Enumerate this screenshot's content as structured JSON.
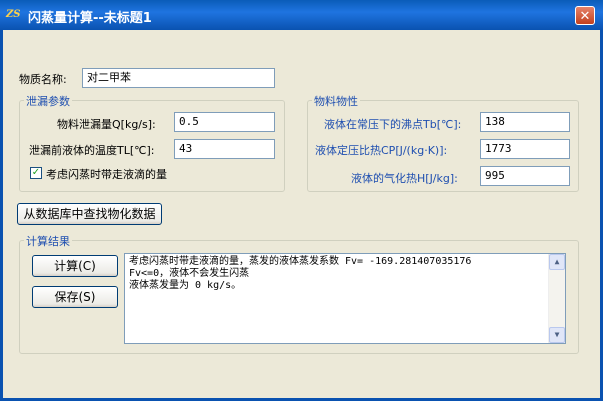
{
  "window": {
    "title": "闪蒸量计算--未标题1",
    "icon": "app-logo-icon",
    "icon_glyph": "ZS",
    "close_label": "✕"
  },
  "substance": {
    "label": "物质名称:",
    "value": "对二甲苯"
  },
  "leak_group": {
    "title": "泄漏参数",
    "leak_rate_label": "物料泄漏量Q[kg/s]:",
    "leak_rate_value": "0.5",
    "temperature_label": "泄漏前液体的温度TL[℃]:",
    "temperature_value": "43",
    "checkbox_label": "考虑闪蒸时带走液滴的量",
    "checkbox_checked": true,
    "check_glyph": "✓"
  },
  "properties_group": {
    "title": "物料物性",
    "boiling_point_label": "液体在常压下的沸点Tb[℃]:",
    "boiling_point_value": "138",
    "specific_heat_label": "液体定压比热CP[J/(kg·K)]:",
    "specific_heat_value": "1773",
    "vaporization_heat_label": "液体的气化热H[J/kg]:",
    "vaporization_heat_value": "995"
  },
  "database_button": "从数据库中查找物化数据",
  "results_group": {
    "title": "计算结果",
    "calculate_button": "计算(C)",
    "save_button": "保存(S)",
    "output_lines": [
      "考虑闪蒸时带走液滴的量，蒸发的液体蒸发系数 Fv= -169.281407035176",
      "Fv<=0，液体不会发生闪蒸",
      "液体蒸发量为 0 kg/s。"
    ],
    "scroll_up_glyph": "▲",
    "scroll_down_glyph": "▼"
  },
  "colors": {
    "title_bar": "#0A52B0",
    "dialog_background": "#ECE9D8",
    "group_title": "#1F4FB0",
    "close_button": "#C2401E"
  }
}
